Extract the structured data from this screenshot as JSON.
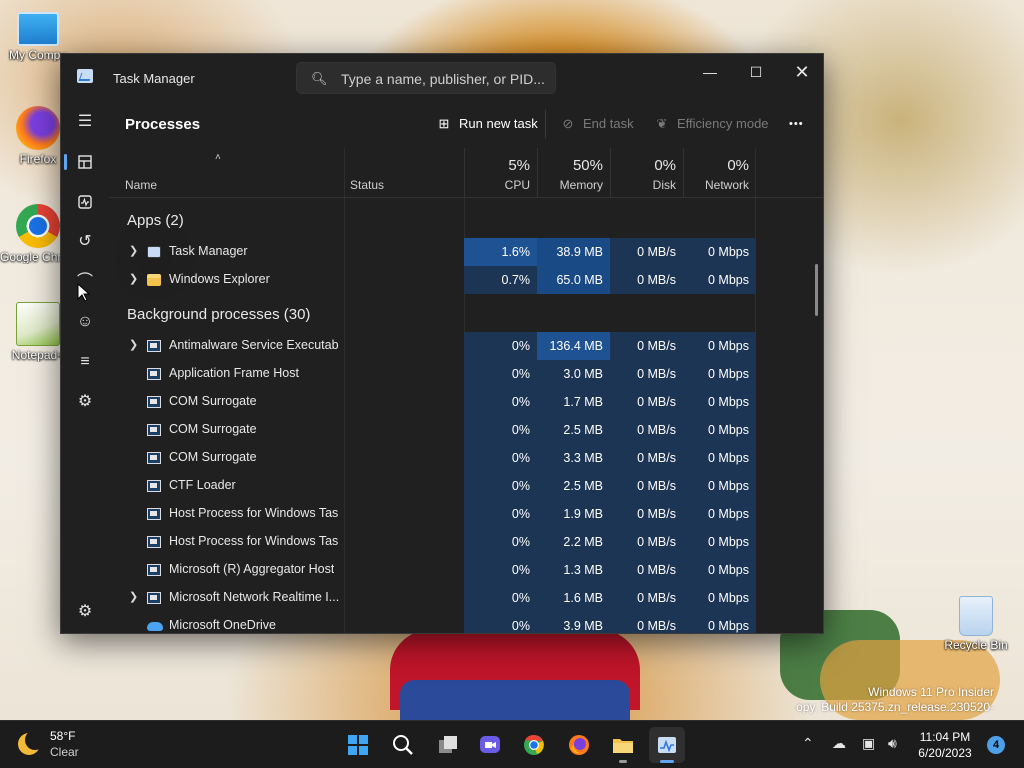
{
  "desktop": {
    "icons": [
      {
        "label": "My Compu"
      },
      {
        "label": "Firefox"
      },
      {
        "label": "Google Chrome"
      },
      {
        "label": "Notepad+"
      },
      {
        "label": "Recycle Bin"
      }
    ],
    "watermark": {
      "line1": "Windows 11 Pro Insider",
      "line2": "opy. Build 25375.zn_release.230520-"
    }
  },
  "window": {
    "title": "Task Manager",
    "search_placeholder": "Type a name, publisher, or PID...",
    "page_title": "Processes",
    "commands": {
      "run_new_task": "Run new task",
      "end_task": "End task",
      "efficiency_mode": "Efficiency mode",
      "more": "•••"
    },
    "columns": {
      "name": "Name",
      "status": "Status",
      "cpu": {
        "pct": "5%",
        "label": "CPU"
      },
      "memory": {
        "pct": "50%",
        "label": "Memory"
      },
      "disk": {
        "pct": "0%",
        "label": "Disk"
      },
      "network": {
        "pct": "0%",
        "label": "Network"
      }
    },
    "groups": {
      "apps": "Apps (2)",
      "background": "Background processes (30)"
    },
    "apps": [
      {
        "name": "Task Manager",
        "cpu": "1.6%",
        "memory": "38.9 MB",
        "disk": "0 MB/s",
        "network": "0 Mbps"
      },
      {
        "name": "Windows Explorer",
        "cpu": "0.7%",
        "memory": "65.0 MB",
        "disk": "0 MB/s",
        "network": "0 Mbps"
      }
    ],
    "background": [
      {
        "name": "Antimalware Service Executable",
        "cpu": "0%",
        "memory": "136.4 MB",
        "disk": "0 MB/s",
        "network": "0 Mbps"
      },
      {
        "name": "Application Frame Host",
        "cpu": "0%",
        "memory": "3.0 MB",
        "disk": "0 MB/s",
        "network": "0 Mbps"
      },
      {
        "name": "COM Surrogate",
        "cpu": "0%",
        "memory": "1.7 MB",
        "disk": "0 MB/s",
        "network": "0 Mbps"
      },
      {
        "name": "COM Surrogate",
        "cpu": "0%",
        "memory": "2.5 MB",
        "disk": "0 MB/s",
        "network": "0 Mbps"
      },
      {
        "name": "COM Surrogate",
        "cpu": "0%",
        "memory": "3.3 MB",
        "disk": "0 MB/s",
        "network": "0 Mbps"
      },
      {
        "name": "CTF Loader",
        "cpu": "0%",
        "memory": "2.5 MB",
        "disk": "0 MB/s",
        "network": "0 Mbps"
      },
      {
        "name": "Host Process for Windows Tasks",
        "cpu": "0%",
        "memory": "1.9 MB",
        "disk": "0 MB/s",
        "network": "0 Mbps"
      },
      {
        "name": "Host Process for Windows Tasks",
        "cpu": "0%",
        "memory": "2.2 MB",
        "disk": "0 MB/s",
        "network": "0 Mbps"
      },
      {
        "name": "Microsoft (R) Aggregator Host",
        "cpu": "0%",
        "memory": "1.3 MB",
        "disk": "0 MB/s",
        "network": "0 Mbps"
      },
      {
        "name": "Microsoft Network Realtime I...",
        "cpu": "0%",
        "memory": "1.6 MB",
        "disk": "0 MB/s",
        "network": "0 Mbps"
      },
      {
        "name": "Microsoft OneDrive",
        "cpu": "0%",
        "memory": "3.9 MB",
        "disk": "0 MB/s",
        "network": "0 Mbps"
      }
    ]
  },
  "taskbar": {
    "weather": {
      "temp": "58°F",
      "condition": "Clear"
    },
    "clock": {
      "time": "11:04 PM",
      "date": "6/20/2023"
    },
    "notifications": "4"
  },
  "colors": {
    "accent": "#60a5f0",
    "window_bg": "#202020",
    "cell_bg": "#1d3555",
    "cell_highlight": "#1f5293"
  }
}
